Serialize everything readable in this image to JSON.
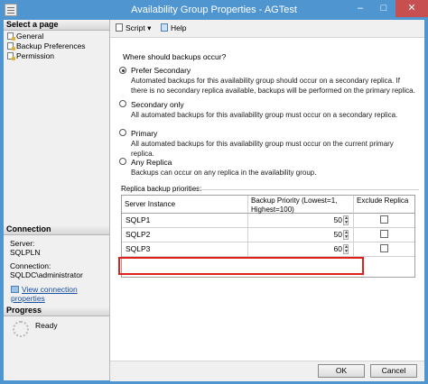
{
  "window": {
    "title": "Availability Group Properties - AGTest",
    "minimize": "–",
    "maximize": "□",
    "close": "✕",
    "icon": "app-window-icon"
  },
  "left": {
    "select_page_header": "Select a page",
    "pages": [
      {
        "label": "General",
        "icon": "page-wrench-icon"
      },
      {
        "label": "Backup Preferences",
        "icon": "page-wrench-icon"
      },
      {
        "label": "Permission",
        "icon": "page-wrench-icon"
      }
    ],
    "connection_header": "Connection",
    "server_label": "Server:",
    "server_value": "SQLPLN",
    "connection_label": "Connection:",
    "connection_value": "SQLDC\\administrator",
    "view_connection_link": "View connection properties",
    "progress_header": "Progress",
    "progress_status": "Ready"
  },
  "toolbar": {
    "script_label": "Script",
    "script_dropdown": "▾",
    "help_label": "Help"
  },
  "main": {
    "question": "Where should backups occur?",
    "options": [
      {
        "label": "Prefer Secondary",
        "checked": true,
        "description": "Automated backups for this availability group should occur on a secondary replica. If there is no secondary replica available, backups will be performed on the primary replica."
      },
      {
        "label": "Secondary only",
        "checked": false,
        "description": "All automated backups for this availability group must occur on a secondary replica."
      },
      {
        "label": "Primary",
        "checked": false,
        "description": "All automated backups for this availability group must occur on the current primary replica."
      },
      {
        "label": "Any Replica",
        "checked": false,
        "description": "Backups can occur on any replica in the availability group."
      }
    ],
    "replica_group_label": "Replica backup priorities:",
    "columns": {
      "server": "Server Instance",
      "priority": "Backup Priority (Lowest=1, Highest=100)",
      "exclude": "Exclude Replica"
    },
    "rows": [
      {
        "server": "SQLP1",
        "priority": "50",
        "exclude": false
      },
      {
        "server": "SQLP2",
        "priority": "50",
        "exclude": false
      },
      {
        "server": "SQLP3",
        "priority": "60",
        "exclude": false
      }
    ]
  },
  "footer": {
    "ok": "OK",
    "cancel": "Cancel"
  },
  "colors": {
    "title_bar": "#4f96d0",
    "close_button": "#c74f4f",
    "highlight": "#e0201c",
    "link": "#1a4fa0"
  }
}
